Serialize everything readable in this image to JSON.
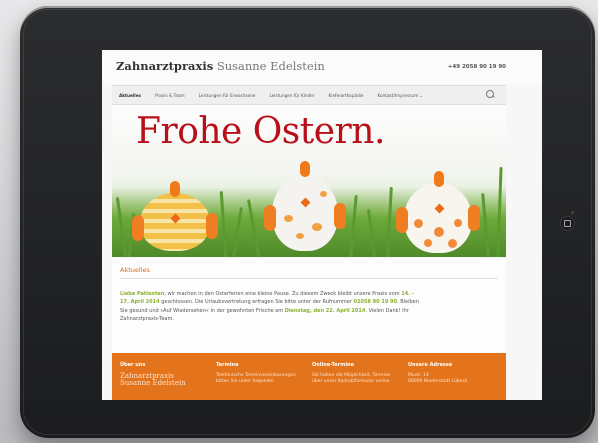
{
  "site": {
    "name_bold": "Zahnarztpraxis",
    "name_rest": "Susanne Edelstein",
    "phone": "+49 2058 90 19 90"
  },
  "nav": {
    "items": [
      "Aktuelles",
      "Praxis & Team",
      "Leistungen für Erwachsene",
      "Leistungen für Kinder",
      "Kieferorthopädie",
      "Kontakt/Impressum ⌄"
    ]
  },
  "hero": {
    "headline": "Frohe Ostern."
  },
  "news": {
    "title": "Aktuelles",
    "p_greeting": "Liebe Patienten",
    "p_text1": ", wir machen in den Osterferien eine kleine Pause. Zu diesem Zweck bleibt unsere Praxis vom ",
    "p_dates": "14. - 17. April 2014",
    "p_text2": " geschlossen. Die Urlaubsvertretung erfragen Sie bitte unter der Rufnummer ",
    "p_phone": "02058 90 19 90",
    "p_text3": ". Bleiben Sie gesund und »Auf Wiedersehen« in der gewohnten Frische am ",
    "p_reopen": "Dienstag, den 22. April 2014",
    "p_text4": ". Vielen Dank! Ihr Zahnarztpraxis-Team."
  },
  "footer": {
    "col1_head": "Über uns",
    "col1_logo1": "Zahnarztpraxis",
    "col1_logo2": "Susanne Edelstein",
    "col2_head": "Termine",
    "col2_l1": "Telefonische Terminvereinbarungen",
    "col2_l2": "bitten Sie unter folgender",
    "col3_head": "Online-Termine",
    "col3_l1": "Sie haben die Möglichkeit, Termine",
    "col3_l2": "über unser Kontaktformular online",
    "col4_head": "Unsere Adresse",
    "col4_l1": "Mustr. 14",
    "col4_l2": "00000 Niederstadt Lübeck"
  },
  "colors": {
    "accent_orange": "#e4741c",
    "headline_red": "#b8101a",
    "highlight_green": "#8ab22a"
  }
}
